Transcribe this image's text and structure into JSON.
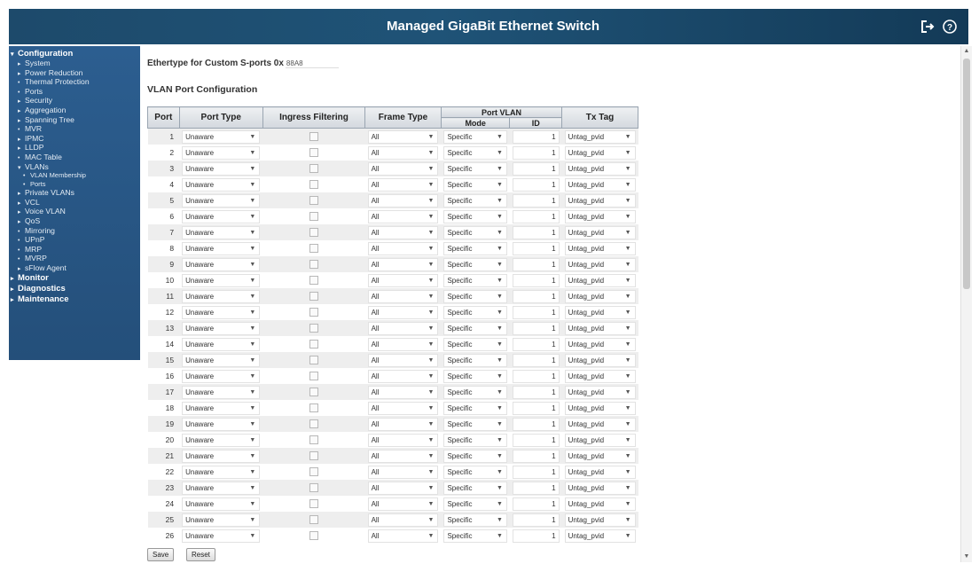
{
  "header": {
    "title": "Managed GigaBit Ethernet Switch",
    "logout_icon": "logout-icon",
    "help_icon": "help-icon"
  },
  "nav": [
    {
      "label": "Configuration",
      "level": "top",
      "mark": "▾"
    },
    {
      "label": "System",
      "level": "l1",
      "mark": "▸"
    },
    {
      "label": "Power Reduction",
      "level": "l1",
      "mark": "▸"
    },
    {
      "label": "Thermal Protection",
      "level": "l1",
      "mark": "•"
    },
    {
      "label": "Ports",
      "level": "l1",
      "mark": "•"
    },
    {
      "label": "Security",
      "level": "l1",
      "mark": "▸"
    },
    {
      "label": "Aggregation",
      "level": "l1",
      "mark": "▸"
    },
    {
      "label": "Spanning Tree",
      "level": "l1",
      "mark": "▸"
    },
    {
      "label": "MVR",
      "level": "l1",
      "mark": "•"
    },
    {
      "label": "IPMC",
      "level": "l1",
      "mark": "▸"
    },
    {
      "label": "LLDP",
      "level": "l1",
      "mark": "▸"
    },
    {
      "label": "MAC Table",
      "level": "l1",
      "mark": "•"
    },
    {
      "label": "VLANs",
      "level": "l1",
      "mark": "▾"
    },
    {
      "label": "VLAN Membership",
      "level": "l2",
      "mark": "•"
    },
    {
      "label": "Ports",
      "level": "l2",
      "mark": "•"
    },
    {
      "label": "Private VLANs",
      "level": "l1",
      "mark": "▸"
    },
    {
      "label": "VCL",
      "level": "l1",
      "mark": "▸"
    },
    {
      "label": "Voice VLAN",
      "level": "l1",
      "mark": "▸"
    },
    {
      "label": "QoS",
      "level": "l1",
      "mark": "▸"
    },
    {
      "label": "Mirroring",
      "level": "l1",
      "mark": "•"
    },
    {
      "label": "UPnP",
      "level": "l1",
      "mark": "•"
    },
    {
      "label": "MRP",
      "level": "l1",
      "mark": "•"
    },
    {
      "label": "MVRP",
      "level": "l1",
      "mark": "•"
    },
    {
      "label": "sFlow Agent",
      "level": "l1",
      "mark": "▸"
    },
    {
      "label": "Monitor",
      "level": "top",
      "mark": "▸"
    },
    {
      "label": "Diagnostics",
      "level": "top",
      "mark": "▸"
    },
    {
      "label": "Maintenance",
      "level": "top",
      "mark": "▸"
    }
  ],
  "ethertype": {
    "label": "Ethertype for Custom S-ports 0x",
    "value": "88A8"
  },
  "section_title": "VLAN Port Configuration",
  "table": {
    "headers": {
      "port": "Port",
      "port_type": "Port Type",
      "ingress": "Ingress Filtering",
      "frame_type": "Frame Type",
      "port_vlan": "Port VLAN",
      "mode": "Mode",
      "id": "ID",
      "tx_tag": "Tx Tag"
    },
    "rows": [
      {
        "port": "1",
        "port_type": "Unaware",
        "frame_type": "All",
        "mode": "Specific",
        "id": "1",
        "tx_tag": "Untag_pvid"
      },
      {
        "port": "2",
        "port_type": "Unaware",
        "frame_type": "All",
        "mode": "Specific",
        "id": "1",
        "tx_tag": "Untag_pvid"
      },
      {
        "port": "3",
        "port_type": "Unaware",
        "frame_type": "All",
        "mode": "Specific",
        "id": "1",
        "tx_tag": "Untag_pvid"
      },
      {
        "port": "4",
        "port_type": "Unaware",
        "frame_type": "All",
        "mode": "Specific",
        "id": "1",
        "tx_tag": "Untag_pvid"
      },
      {
        "port": "5",
        "port_type": "Unaware",
        "frame_type": "All",
        "mode": "Specific",
        "id": "1",
        "tx_tag": "Untag_pvid"
      },
      {
        "port": "6",
        "port_type": "Unaware",
        "frame_type": "All",
        "mode": "Specific",
        "id": "1",
        "tx_tag": "Untag_pvid"
      },
      {
        "port": "7",
        "port_type": "Unaware",
        "frame_type": "All",
        "mode": "Specific",
        "id": "1",
        "tx_tag": "Untag_pvid"
      },
      {
        "port": "8",
        "port_type": "Unaware",
        "frame_type": "All",
        "mode": "Specific",
        "id": "1",
        "tx_tag": "Untag_pvid"
      },
      {
        "port": "9",
        "port_type": "Unaware",
        "frame_type": "All",
        "mode": "Specific",
        "id": "1",
        "tx_tag": "Untag_pvid"
      },
      {
        "port": "10",
        "port_type": "Unaware",
        "frame_type": "All",
        "mode": "Specific",
        "id": "1",
        "tx_tag": "Untag_pvid"
      },
      {
        "port": "11",
        "port_type": "Unaware",
        "frame_type": "All",
        "mode": "Specific",
        "id": "1",
        "tx_tag": "Untag_pvid"
      },
      {
        "port": "12",
        "port_type": "Unaware",
        "frame_type": "All",
        "mode": "Specific",
        "id": "1",
        "tx_tag": "Untag_pvid"
      },
      {
        "port": "13",
        "port_type": "Unaware",
        "frame_type": "All",
        "mode": "Specific",
        "id": "1",
        "tx_tag": "Untag_pvid"
      },
      {
        "port": "14",
        "port_type": "Unaware",
        "frame_type": "All",
        "mode": "Specific",
        "id": "1",
        "tx_tag": "Untag_pvid"
      },
      {
        "port": "15",
        "port_type": "Unaware",
        "frame_type": "All",
        "mode": "Specific",
        "id": "1",
        "tx_tag": "Untag_pvid"
      },
      {
        "port": "16",
        "port_type": "Unaware",
        "frame_type": "All",
        "mode": "Specific",
        "id": "1",
        "tx_tag": "Untag_pvid"
      },
      {
        "port": "17",
        "port_type": "Unaware",
        "frame_type": "All",
        "mode": "Specific",
        "id": "1",
        "tx_tag": "Untag_pvid"
      },
      {
        "port": "18",
        "port_type": "Unaware",
        "frame_type": "All",
        "mode": "Specific",
        "id": "1",
        "tx_tag": "Untag_pvid"
      },
      {
        "port": "19",
        "port_type": "Unaware",
        "frame_type": "All",
        "mode": "Specific",
        "id": "1",
        "tx_tag": "Untag_pvid"
      },
      {
        "port": "20",
        "port_type": "Unaware",
        "frame_type": "All",
        "mode": "Specific",
        "id": "1",
        "tx_tag": "Untag_pvid"
      },
      {
        "port": "21",
        "port_type": "Unaware",
        "frame_type": "All",
        "mode": "Specific",
        "id": "1",
        "tx_tag": "Untag_pvid"
      },
      {
        "port": "22",
        "port_type": "Unaware",
        "frame_type": "All",
        "mode": "Specific",
        "id": "1",
        "tx_tag": "Untag_pvid"
      },
      {
        "port": "23",
        "port_type": "Unaware",
        "frame_type": "All",
        "mode": "Specific",
        "id": "1",
        "tx_tag": "Untag_pvid"
      },
      {
        "port": "24",
        "port_type": "Unaware",
        "frame_type": "All",
        "mode": "Specific",
        "id": "1",
        "tx_tag": "Untag_pvid"
      },
      {
        "port": "25",
        "port_type": "Unaware",
        "frame_type": "All",
        "mode": "Specific",
        "id": "1",
        "tx_tag": "Untag_pvid"
      },
      {
        "port": "26",
        "port_type": "Unaware",
        "frame_type": "All",
        "mode": "Specific",
        "id": "1",
        "tx_tag": "Untag_pvid"
      }
    ]
  },
  "buttons": {
    "save": "Save",
    "reset": "Reset"
  }
}
